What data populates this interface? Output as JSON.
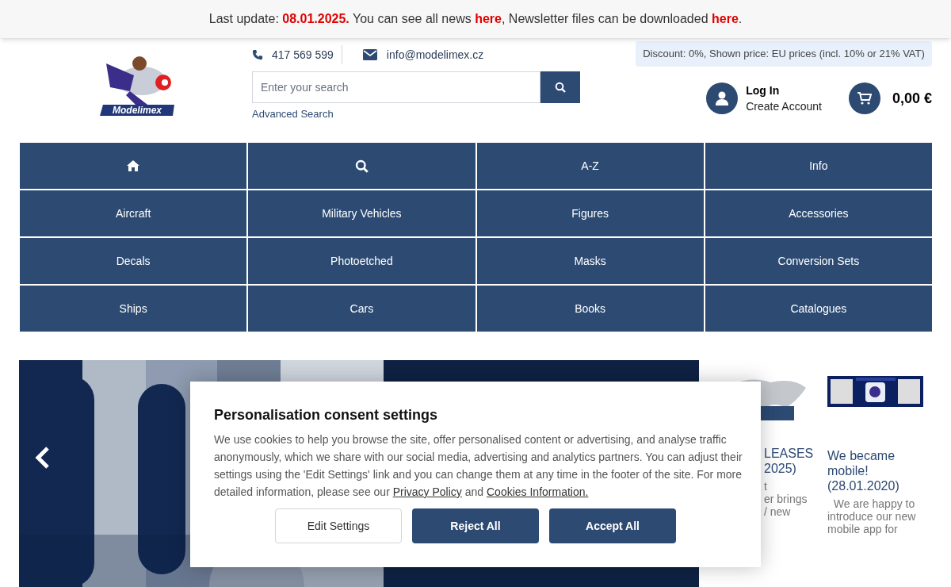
{
  "notice": [
    {
      "kind": "plain",
      "text": "Last update: "
    },
    {
      "kind": "date",
      "text": "08.01.2025."
    },
    {
      "kind": "plain",
      "text": " You can see all news "
    },
    {
      "kind": "link",
      "text": "here"
    },
    {
      "kind": "plain",
      "text": ", Newsletter files can be downloaded "
    },
    {
      "kind": "link",
      "text": "here"
    },
    {
      "kind": "plain",
      "text": "."
    }
  ],
  "header": {
    "logo_text": "Modelimex",
    "phone": "417 569 599",
    "email": "info@modelimex.cz",
    "search": {
      "placeholder": "Enter your search"
    },
    "advanced_search": "Advanced Search",
    "discount": "Discount: 0%, Shown price: EU prices (incl. 10% or 21% VAT)",
    "login": "Log In",
    "create_account": "Create Account",
    "cart_total": "0,00 €"
  },
  "nav": [
    {
      "kind": "home"
    },
    {
      "kind": "search"
    },
    {
      "kind": "text",
      "label": "A-Z"
    },
    {
      "kind": "text",
      "label": "Info"
    },
    {
      "kind": "text",
      "label": "Aircraft"
    },
    {
      "kind": "text",
      "label": "Military Vehicles"
    },
    {
      "kind": "text",
      "label": "Figures"
    },
    {
      "kind": "text",
      "label": "Accessories"
    },
    {
      "kind": "text",
      "label": "Decals"
    },
    {
      "kind": "text",
      "label": "Photoetched"
    },
    {
      "kind": "text",
      "label": "Masks"
    },
    {
      "kind": "text",
      "label": "Conversion Sets"
    },
    {
      "kind": "text",
      "label": "Ships"
    },
    {
      "kind": "text",
      "label": "Cars"
    },
    {
      "kind": "text",
      "label": "Books"
    },
    {
      "kind": "text",
      "label": "Catalogues"
    }
  ],
  "news": [
    {
      "title_lines": [
        "LEASES",
        "2025)"
      ],
      "body_lines": [
        "t",
        "er brings",
        "/ new"
      ]
    },
    {
      "title_lines": [
        "We became",
        "mobile!",
        "(28.01.2020)"
      ],
      "body_lines": [
        "  We are happy to",
        "introduce our new",
        "mobile app for"
      ]
    }
  ],
  "consent": {
    "title": "Personalisation consent settings",
    "text": [
      {
        "kind": "plain",
        "text": "We use cookies to help you browse the site, offer personalised content or advertising, and analyse traffic anonymously, which we share with our social media, advertising and analytics partners. You can adjust their settings using the 'Edit Settings' link and you can change them at any time in the footer of the site. For more detailed information, please see our "
      },
      {
        "kind": "link",
        "text": "Privacy Policy"
      },
      {
        "kind": "plain",
        "text": " and "
      },
      {
        "kind": "link",
        "text": "Cookies Information."
      }
    ],
    "buttons": [
      {
        "kind": "outline",
        "label": "Edit Settings"
      },
      {
        "kind": "filled",
        "label": "Reject All"
      },
      {
        "kind": "filled",
        "label": "Accept All"
      }
    ]
  }
}
